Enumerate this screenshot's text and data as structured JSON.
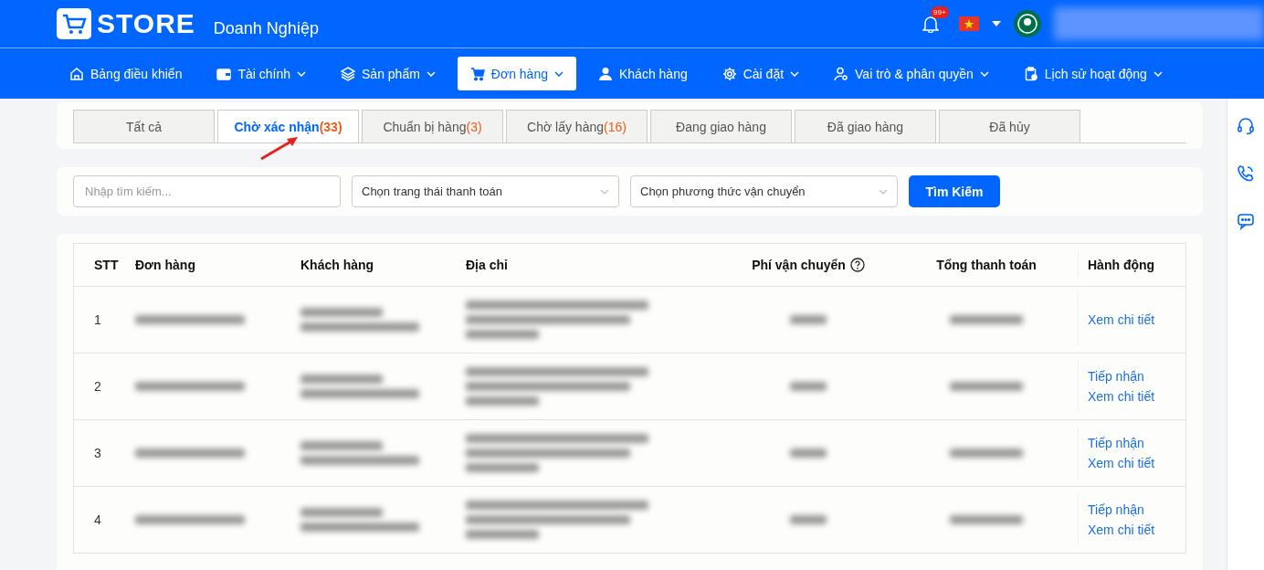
{
  "header": {
    "logo_text": "STORE",
    "subtitle": "Doanh Nghiệp",
    "notification_badge": "99+"
  },
  "nav": [
    {
      "label": "Bảng điều khiển",
      "dropdown": false,
      "selected": false
    },
    {
      "label": "Tài chính",
      "dropdown": true,
      "selected": false
    },
    {
      "label": "Sản phẩm",
      "dropdown": true,
      "selected": false
    },
    {
      "label": "Đơn hàng",
      "dropdown": true,
      "selected": true
    },
    {
      "label": "Khách hàng",
      "dropdown": false,
      "selected": false
    },
    {
      "label": "Cài đặt",
      "dropdown": true,
      "selected": false
    },
    {
      "label": "Vai trò & phân quyền",
      "dropdown": true,
      "selected": false
    },
    {
      "label": "Lịch sử hoạt động",
      "dropdown": true,
      "selected": false
    }
  ],
  "tabs": [
    {
      "label": "Tất cả",
      "selected": false
    },
    {
      "label": "Chờ xác nhận",
      "count": "(33)",
      "selected": true
    },
    {
      "label": "Chuẩn bị hàng",
      "count": "(3)",
      "selected": false
    },
    {
      "label": "Chờ lấy hàng",
      "count": "(16)",
      "selected": false
    },
    {
      "label": "Đang giao hàng",
      "selected": false
    },
    {
      "label": "Đã giao hàng",
      "selected": false
    },
    {
      "label": "Đã hủy",
      "selected": false
    }
  ],
  "filters": {
    "search": {
      "placeholder": "Nhập tìm kiếm..."
    },
    "payment_status": {
      "value": "Chọn trang thái thanh toán"
    },
    "shipping_method": {
      "value": "Chọn phương thức vận chuyển"
    },
    "search_button": "Tìm Kiếm"
  },
  "table": {
    "columns": [
      "STT",
      "Đơn hàng",
      "Khách hàng",
      "Địa chỉ",
      "Phí vận chuyển",
      "Tổng thanh toán",
      "Hành động"
    ],
    "rows": [
      {
        "stt": "1",
        "actions": [
          "Xem chi tiết"
        ]
      },
      {
        "stt": "2",
        "actions": [
          "Tiếp nhận",
          "Xem chi tiết"
        ]
      },
      {
        "stt": "3",
        "actions": [
          "Tiếp nhận",
          "Xem chi tiết"
        ]
      },
      {
        "stt": "4",
        "actions": [
          "Tiếp nhận",
          "Xem chi tiết"
        ]
      }
    ]
  }
}
